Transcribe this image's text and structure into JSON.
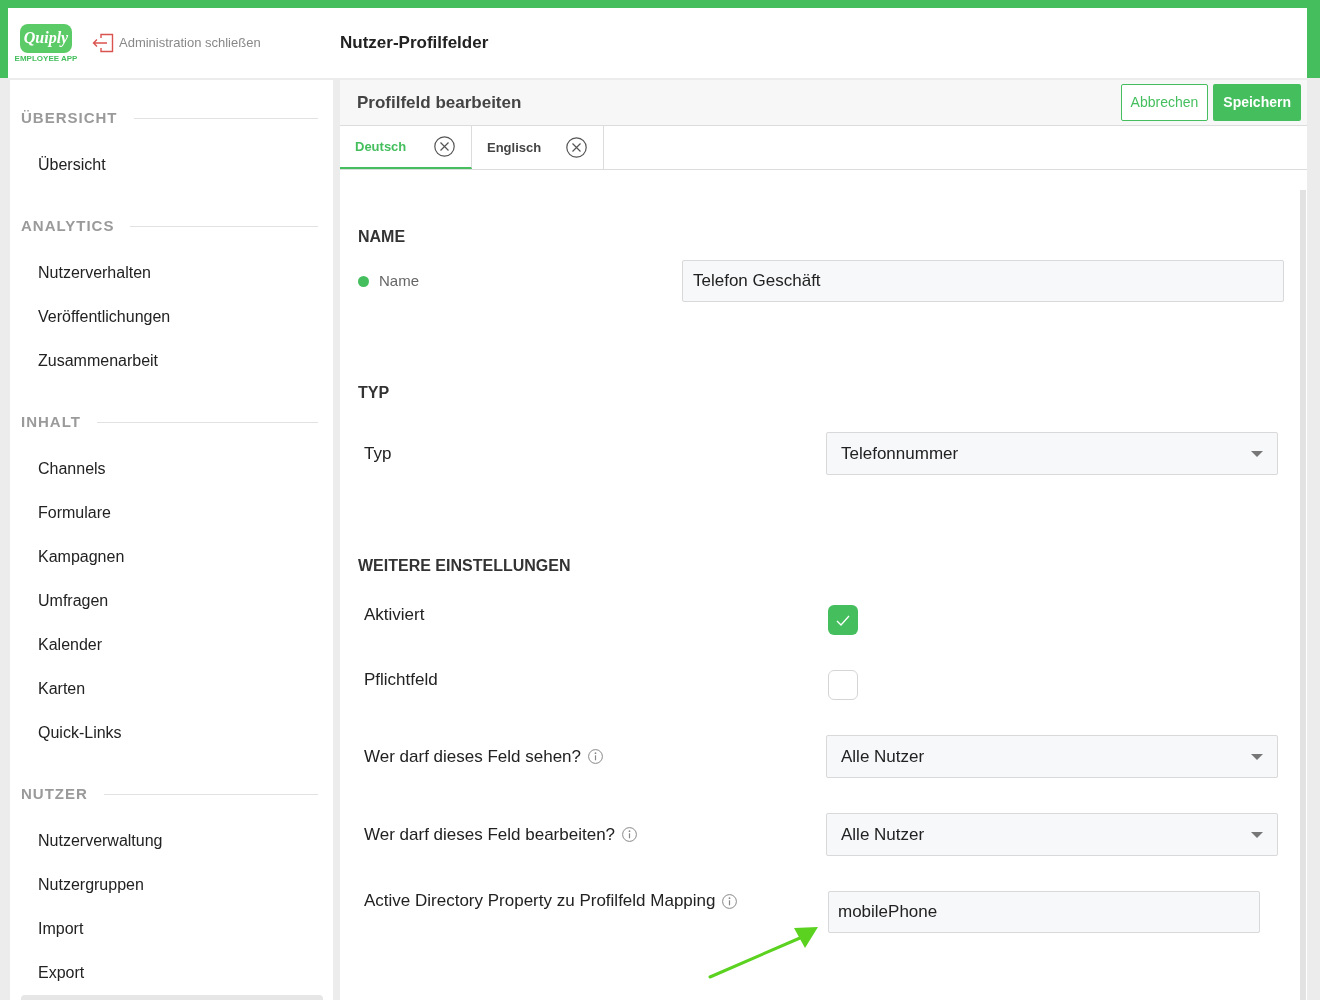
{
  "header": {
    "logo": {
      "wordmark": "Quiply",
      "tagline": "EMPLOYEE APP"
    },
    "close_link": "Administration schließen",
    "title": "Nutzer-Profilfelder"
  },
  "sidebar": {
    "sections": [
      {
        "heading": "ÜBERSICHT",
        "items": [
          {
            "label": "Übersicht",
            "selected": false
          }
        ]
      },
      {
        "heading": "ANALYTICS",
        "items": [
          {
            "label": "Nutzerverhalten",
            "selected": false
          },
          {
            "label": "Veröffentlichungen",
            "selected": false
          },
          {
            "label": "Zusammenarbeit",
            "selected": false
          }
        ]
      },
      {
        "heading": "INHALT",
        "items": [
          {
            "label": "Channels",
            "selected": false
          },
          {
            "label": "Formulare",
            "selected": false
          },
          {
            "label": "Kampagnen",
            "selected": false
          },
          {
            "label": "Umfragen",
            "selected": false
          },
          {
            "label": "Kalender",
            "selected": false
          },
          {
            "label": "Karten",
            "selected": false
          },
          {
            "label": "Quick-Links",
            "selected": false
          }
        ]
      },
      {
        "heading": "NUTZER",
        "items": [
          {
            "label": "Nutzerverwaltung",
            "selected": false
          },
          {
            "label": "Nutzergruppen",
            "selected": false
          },
          {
            "label": "Import",
            "selected": false
          },
          {
            "label": "Export",
            "selected": false
          },
          {
            "selected": true
          }
        ]
      }
    ]
  },
  "panel": {
    "title": "Profilfeld bearbeiten",
    "buttons": [
      {
        "label": "Abbrechen",
        "kind": "outline"
      },
      {
        "label": "Speichern",
        "kind": "primary"
      }
    ],
    "tabs": [
      {
        "label": "Deutsch",
        "selected": true
      },
      {
        "label": "Englisch",
        "selected": false
      }
    ],
    "sections": [
      {
        "heading": "NAME",
        "rows": [
          {
            "kind": "localized_text",
            "label": "Name",
            "value": "Telefon Geschäft"
          }
        ]
      },
      {
        "heading": "TYP",
        "rows": [
          {
            "kind": "select",
            "label": "Typ",
            "value": "Telefonnummer"
          }
        ]
      },
      {
        "heading": "WEITERE EINSTELLUNGEN",
        "rows": [
          {
            "kind": "checkbox",
            "label": "Aktiviert",
            "checked": true
          },
          {
            "kind": "checkbox",
            "label": "Pflichtfeld",
            "checked": false
          },
          {
            "kind": "select",
            "label": "Wer darf dieses Feld sehen?",
            "value": "Alle Nutzer",
            "info": true
          },
          {
            "kind": "select",
            "label": "Wer darf dieses Feld bearbeiten?",
            "value": "Alle Nutzer",
            "info": true
          },
          {
            "kind": "text",
            "label": "Active Directory Property zu Profilfeld Mapping",
            "value": "mobilePhone",
            "info": true
          }
        ]
      }
    ]
  }
}
